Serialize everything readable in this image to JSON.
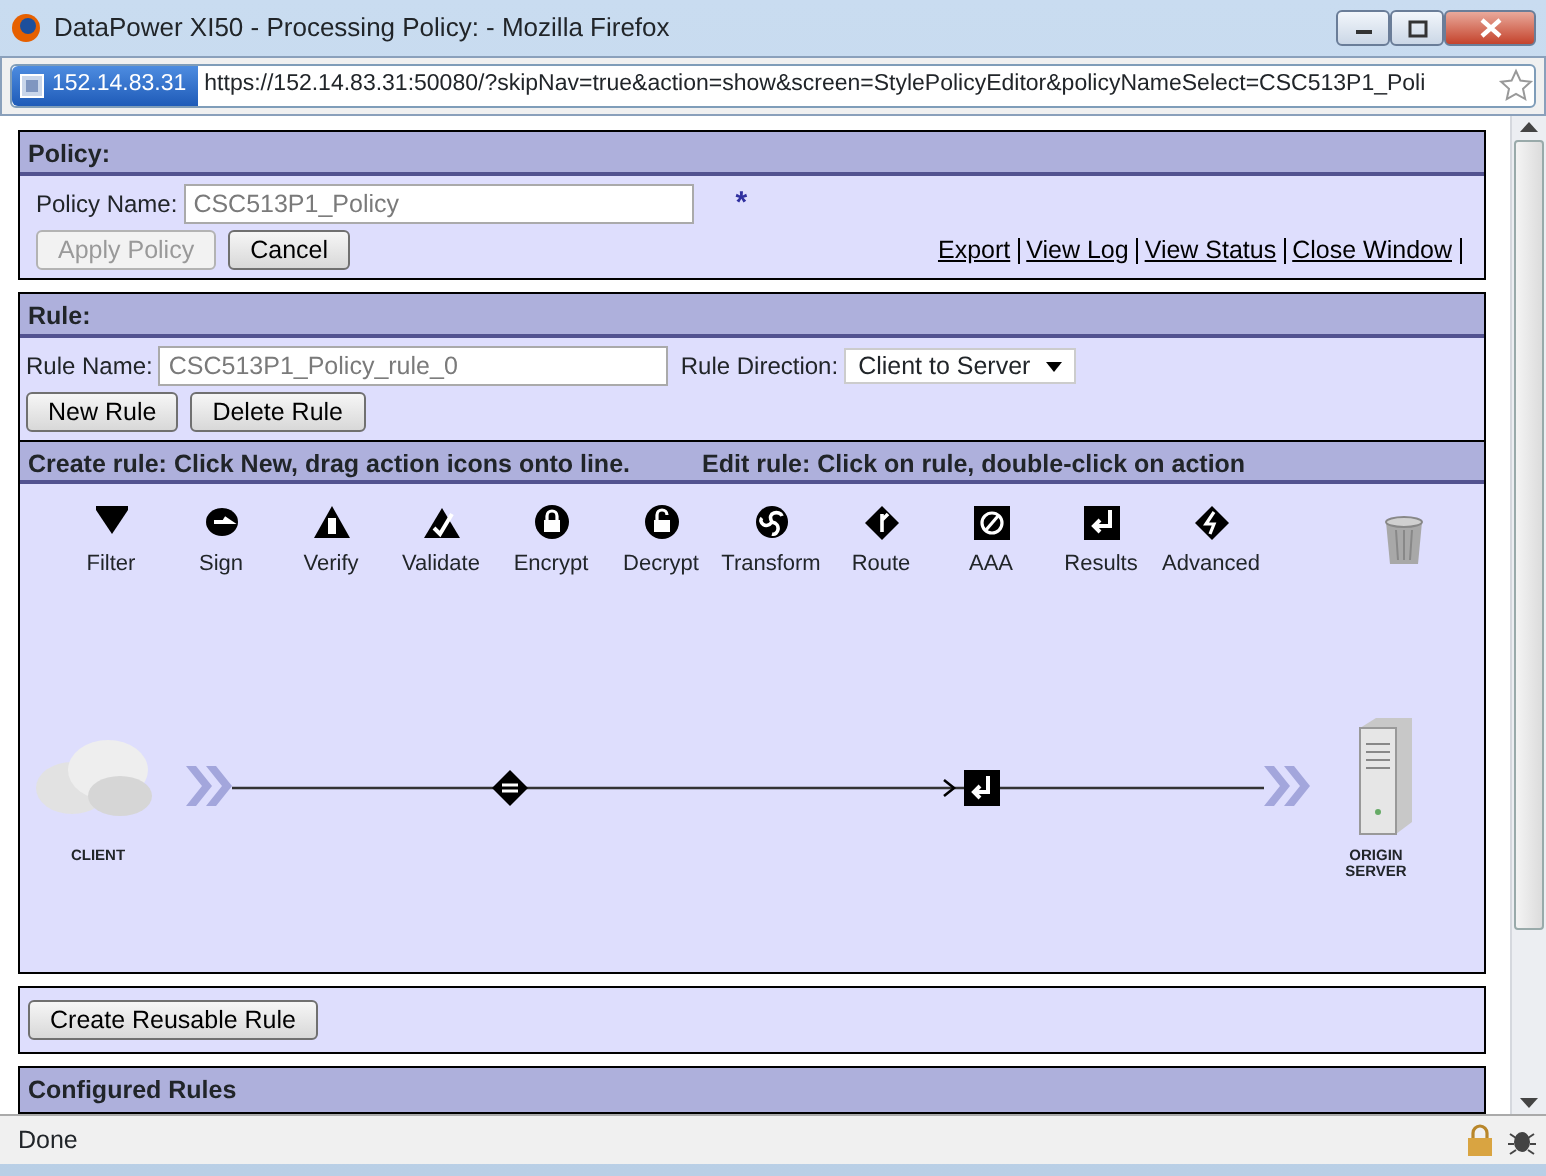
{
  "window": {
    "title": "DataPower XI50 - Processing Policy: - Mozilla Firefox"
  },
  "address_bar": {
    "site": "152.14.83.31",
    "url": "https://152.14.83.31:50080/?skipNav=true&action=show&screen=StylePolicyEditor&policyNameSelect=CSC513P1_Poli"
  },
  "policy": {
    "header": "Policy:",
    "name_label": "Policy Name:",
    "name_value": "CSC513P1_Policy",
    "required_mark": "*",
    "buttons": [
      {
        "label": "Apply Policy",
        "disabled": true
      },
      {
        "label": "Cancel",
        "disabled": false
      }
    ],
    "links": [
      "Export",
      "View Log",
      "View Status",
      "Close Window"
    ]
  },
  "rule": {
    "header": "Rule:",
    "name_label": "Rule Name:",
    "name_value": "CSC513P1_Policy_rule_0",
    "direction_label": "Rule Direction:",
    "direction_value": "Client to Server",
    "buttons": [
      "New Rule",
      "Delete Rule"
    ]
  },
  "editor": {
    "header_create": "Create rule: Click New, drag action icons onto line.",
    "header_edit": "Edit rule: Click on rule, double-click on action",
    "actions": [
      "Filter",
      "Sign",
      "Verify",
      "Validate",
      "Encrypt",
      "Decrypt",
      "Transform",
      "Route",
      "AAA",
      "Results",
      "Advanced"
    ],
    "client_label": "CLIENT",
    "server_label": "ORIGIN SERVER",
    "rule_actions": [
      {
        "kind": "match"
      },
      {
        "kind": "results"
      }
    ]
  },
  "reusable_button": "Create Reusable Rule",
  "configured_header": "Configured Rules",
  "status_bar": {
    "text": "Done"
  }
}
